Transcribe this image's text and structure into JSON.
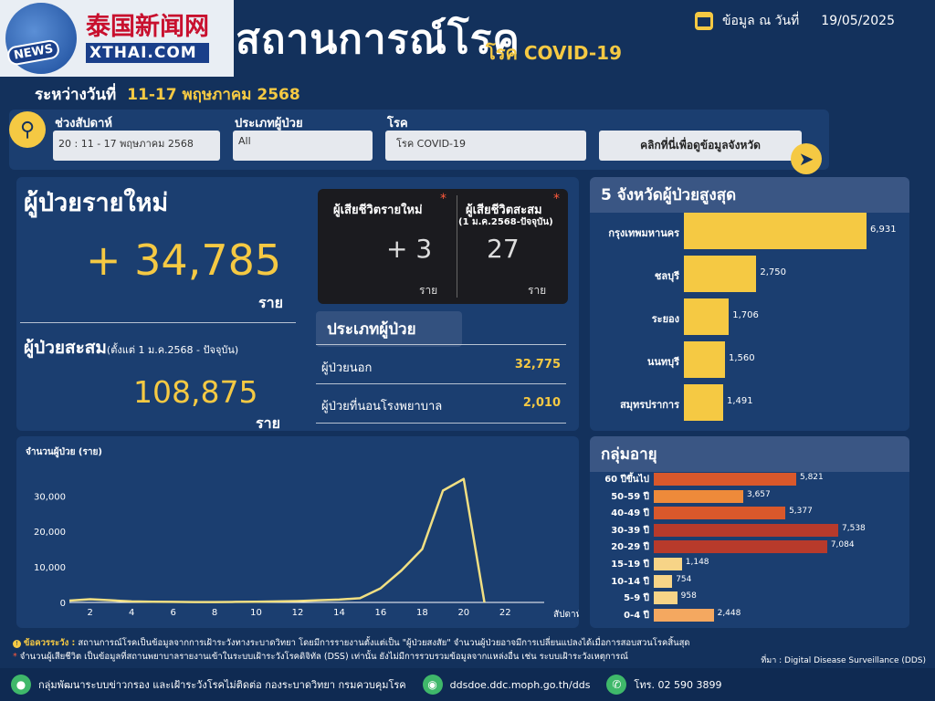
{
  "header": {
    "title": "สถานการณ์โรค",
    "subtitle": "โรค COVID-19",
    "date_label": "ข้อมูล ณ วันที่",
    "date_value": "19/05/2025",
    "range_label": "ระหว่างวันที่",
    "range_value": "11-17 พฤษภาคม 2568"
  },
  "logo": {
    "cn": "泰国新闻网",
    "en": "XTHAI.COM",
    "badge": "NEWS"
  },
  "filters": {
    "week_label": "ช่วงสัปดาห์",
    "week_value": "20 : 11 - 17 พฤษภาคม 2568",
    "patient_type_label": "ประเภทผู้ป่วย",
    "patient_type_value": "All",
    "disease_label": "โรค",
    "disease_value": "โรค COVID-19",
    "province_button": "คลิกที่นี่เพื่อดูข้อมูลจังหวัด"
  },
  "new_cases": {
    "title": "ผู้ป่วยรายใหม่",
    "value": "+ 34,785",
    "unit": "ราย"
  },
  "cumulative": {
    "title": "ผู้ป่วยสะสม",
    "note": "(ตั้งแต่ 1 ม.ค.2568 - ปัจจุบัน)",
    "value": "108,875",
    "unit": "ราย"
  },
  "deaths": {
    "new_label": "ผู้เสียชีวิตรายใหม่",
    "new_value": "+ 3",
    "cum_label": "ผู้เสียชีวิตสะสม",
    "cum_note": "(1 ม.ค.2568-ปัจจุบัน)",
    "cum_value": "27",
    "unit": "ราย",
    "star": "*"
  },
  "patient_types": {
    "title": "ประเภทผู้ป่วย",
    "rows": [
      {
        "label": "ผู้ป่วยนอก",
        "value": "32,775"
      },
      {
        "label": "ผู้ป่วยที่นอนโรงพยาบาล",
        "value": "2,010"
      }
    ]
  },
  "top_provinces": {
    "title": "5 จังหวัดผู้ป่วยสูงสุด",
    "items": [
      {
        "name": "กรุงเทพมหานคร",
        "value": 6931,
        "label": "6,931"
      },
      {
        "name": "ชลบุรี",
        "value": 2750,
        "label": "2,750"
      },
      {
        "name": "ระยอง",
        "value": 1706,
        "label": "1,706"
      },
      {
        "name": "นนทบุรี",
        "value": 1560,
        "label": "1,560"
      },
      {
        "name": "สมุทรปราการ",
        "value": 1491,
        "label": "1,491"
      }
    ],
    "color": "#f5c943"
  },
  "age_groups": {
    "title": "กลุ่มอายุ",
    "items": [
      {
        "name": "60 ปีขึ้นไป",
        "value": 5821,
        "label": "5,821",
        "color": "#d9582b"
      },
      {
        "name": "50-59 ปี",
        "value": 3657,
        "label": "3,657",
        "color": "#ee8a3a"
      },
      {
        "name": "40-49 ปี",
        "value": 5377,
        "label": "5,377",
        "color": "#d9582b"
      },
      {
        "name": "30-39 ปี",
        "value": 7538,
        "label": "7,538",
        "color": "#b83a2b"
      },
      {
        "name": "20-29 ปี",
        "value": 7084,
        "label": "7,084",
        "color": "#b83a2b"
      },
      {
        "name": "15-19 ปี",
        "value": 1148,
        "label": "1,148",
        "color": "#f7d487"
      },
      {
        "name": "10-14 ปี",
        "value": 754,
        "label": "754",
        "color": "#f7d487"
      },
      {
        "name": "5-9 ปี",
        "value": 958,
        "label": "958",
        "color": "#f7d487"
      },
      {
        "name": "0-4 ปี",
        "value": 2448,
        "label": "2,448",
        "color": "#f4a860"
      }
    ]
  },
  "chart_data": {
    "type": "line",
    "ylabel": "จำนวนผู้ป่วย (ราย)",
    "xlabel": "สัปดาห์",
    "x": [
      1,
      2,
      3,
      4,
      5,
      6,
      7,
      8,
      9,
      10,
      11,
      12,
      13,
      14,
      15,
      16,
      17,
      18,
      19,
      20,
      21
    ],
    "y": [
      500,
      900,
      600,
      300,
      200,
      150,
      100,
      100,
      150,
      200,
      300,
      400,
      600,
      800,
      1200,
      4000,
      9000,
      15000,
      31500,
      34785,
      0
    ],
    "xticks": [
      2,
      4,
      6,
      8,
      10,
      12,
      14,
      16,
      18,
      20,
      22
    ],
    "yticks": [
      0,
      10000,
      20000,
      30000
    ],
    "ytick_labels": [
      "0",
      "10,000",
      "20,000",
      "30,000"
    ],
    "xlim": [
      1,
      23
    ],
    "ylim": [
      0,
      36000
    ],
    "color": "#f1df82"
  },
  "footnotes": {
    "caution_label": "ข้อควรระวัง :",
    "caution_text": "สถานการณ์โรคเป็นข้อมูลจากการเฝ้าระวังทางระบาดวิทยา โดยมีการรายงานตั้งแต่เป็น \"ผู้ป่วยสงสัย\" จำนวนผู้ป่วยอาจมีการเปลี่ยนแปลงได้เมื่อการสอบสวนโรคสิ้นสุด",
    "death_note": "จำนวนผู้เสียชีวิต เป็นข้อมูลที่สถานพยาบาลรายงานเข้าในระบบเฝ้าระวังโรคดิจิทัล (DSS) เท่านั้น ยังไม่มีการรวบรวมข้อมูลจากแหล่งอื่น เช่น ระบบเฝ้าระวังเหตุการณ์",
    "source": "ที่มา :  Digital Disease Surveillance (DDS)"
  },
  "bottom": {
    "dept": "กลุ่มพัฒนาระบบข่าวกรอง และเฝ้าระวังโรคไม่ติดต่อ กองระบาดวิทยา กรมควบคุมโรค",
    "website": "ddsdoe.ddc.moph.go.th/dds",
    "phone": "โทร.  02 590 3899"
  }
}
